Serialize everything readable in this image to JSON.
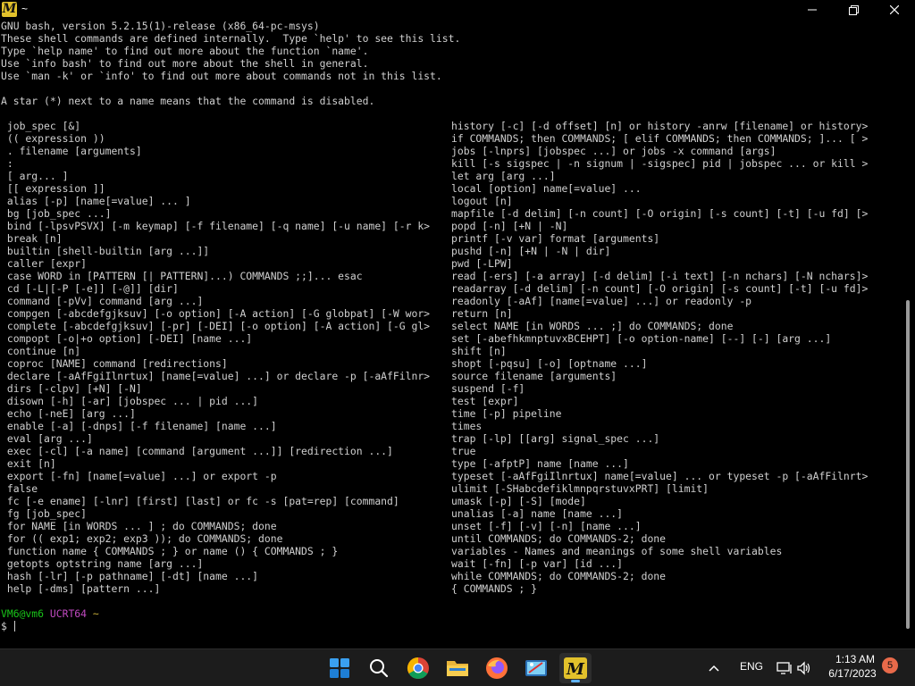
{
  "window": {
    "title": "~",
    "app_icon_letter": "M"
  },
  "terminal": {
    "header_lines": [
      "GNU bash, version 5.2.15(1)-release (x86_64-pc-msys)",
      "These shell commands are defined internally.  Type `help' to see this list.",
      "Type `help name' to find out more about the function `name'.",
      "Use `info bash' to find out more about the shell in general.",
      "Use `man -k' or `info' to find out more about commands not in this list.",
      "",
      "A star (*) next to a name means that the command is disabled.",
      ""
    ],
    "left_column": [
      " job_spec [&]",
      " (( expression ))",
      " . filename [arguments]",
      " :",
      " [ arg... ]",
      " [[ expression ]]",
      " alias [-p] [name[=value] ... ]",
      " bg [job_spec ...]",
      " bind [-lpsvPSVX] [-m keymap] [-f filename] [-q name] [-u name] [-r k>",
      " break [n]",
      " builtin [shell-builtin [arg ...]]",
      " caller [expr]",
      " case WORD in [PATTERN [| PATTERN]...) COMMANDS ;;]... esac",
      " cd [-L|[-P [-e]] [-@]] [dir]",
      " command [-pVv] command [arg ...]",
      " compgen [-abcdefgjksuv] [-o option] [-A action] [-G globpat] [-W wor>",
      " complete [-abcdefgjksuv] [-pr] [-DEI] [-o option] [-A action] [-G gl>",
      " compopt [-o|+o option] [-DEI] [name ...]",
      " continue [n]",
      " coproc [NAME] command [redirections]",
      " declare [-aAfFgiIlnrtux] [name[=value] ...] or declare -p [-aAfFilnr>",
      " dirs [-clpv] [+N] [-N]",
      " disown [-h] [-ar] [jobspec ... | pid ...]",
      " echo [-neE] [arg ...]",
      " enable [-a] [-dnps] [-f filename] [name ...]",
      " eval [arg ...]",
      " exec [-cl] [-a name] [command [argument ...]] [redirection ...]",
      " exit [n]",
      " export [-fn] [name[=value] ...] or export -p",
      " false",
      " fc [-e ename] [-lnr] [first] [last] or fc -s [pat=rep] [command]",
      " fg [job_spec]",
      " for NAME [in WORDS ... ] ; do COMMANDS; done",
      " for (( exp1; exp2; exp3 )); do COMMANDS; done",
      " function name { COMMANDS ; } or name () { COMMANDS ; }",
      " getopts optstring name [arg ...]",
      " hash [-lr] [-p pathname] [-dt] [name ...]",
      " help [-dms] [pattern ...]"
    ],
    "right_column": [
      "history [-c] [-d offset] [n] or history -anrw [filename] or history>",
      "if COMMANDS; then COMMANDS; [ elif COMMANDS; then COMMANDS; ]... [ >",
      "jobs [-lnprs] [jobspec ...] or jobs -x command [args]",
      "kill [-s sigspec | -n signum | -sigspec] pid | jobspec ... or kill >",
      "let arg [arg ...]",
      "local [option] name[=value] ...",
      "logout [n]",
      "mapfile [-d delim] [-n count] [-O origin] [-s count] [-t] [-u fd] [>",
      "popd [-n] [+N | -N]",
      "printf [-v var] format [arguments]",
      "pushd [-n] [+N | -N | dir]",
      "pwd [-LPW]",
      "read [-ers] [-a array] [-d delim] [-i text] [-n nchars] [-N nchars]>",
      "readarray [-d delim] [-n count] [-O origin] [-s count] [-t] [-u fd]>",
      "readonly [-aAf] [name[=value] ...] or readonly -p",
      "return [n]",
      "select NAME [in WORDS ... ;] do COMMANDS; done",
      "set [-abefhkmnptuvxBCEHPT] [-o option-name] [--] [-] [arg ...]",
      "shift [n]",
      "shopt [-pqsu] [-o] [optname ...]",
      "source filename [arguments]",
      "suspend [-f]",
      "test [expr]",
      "time [-p] pipeline",
      "times",
      "trap [-lp] [[arg] signal_spec ...]",
      "true",
      "type [-afptP] name [name ...]",
      "typeset [-aAfFgiIlnrtux] name[=value] ... or typeset -p [-aAfFilnrt>",
      "ulimit [-SHabcdefiklmnpqrstuvxPRT] [limit]",
      "umask [-p] [-S] [mode]",
      "unalias [-a] name [name ...]",
      "unset [-f] [-v] [-n] [name ...]",
      "until COMMANDS; do COMMANDS-2; done",
      "variables - Names and meanings of some shell variables",
      "wait [-fn] [-p var] [id ...]",
      "while COMMANDS; do COMMANDS-2; done",
      "{ COMMANDS ; }"
    ],
    "prompt": {
      "user_host": "VM6@vm6",
      "env": "UCRT64",
      "path": "~",
      "symbol": "$"
    }
  },
  "taskbar": {
    "apps": [
      "start",
      "search",
      "chrome",
      "file-explorer",
      "firefox",
      "snipping-tool",
      "msys2"
    ],
    "tray": {
      "language": "ENG",
      "time": "1:13 AM",
      "date": "6/17/2023",
      "notification_count": "5"
    }
  },
  "colors": {
    "background": "#000000",
    "text": "#d0d0d0",
    "prompt_user": "#19c419",
    "prompt_env": "#c04ac0",
    "prompt_path": "#c8b03a",
    "taskbar": "#1c1c1c",
    "notification_badge": "#e86a4a"
  }
}
